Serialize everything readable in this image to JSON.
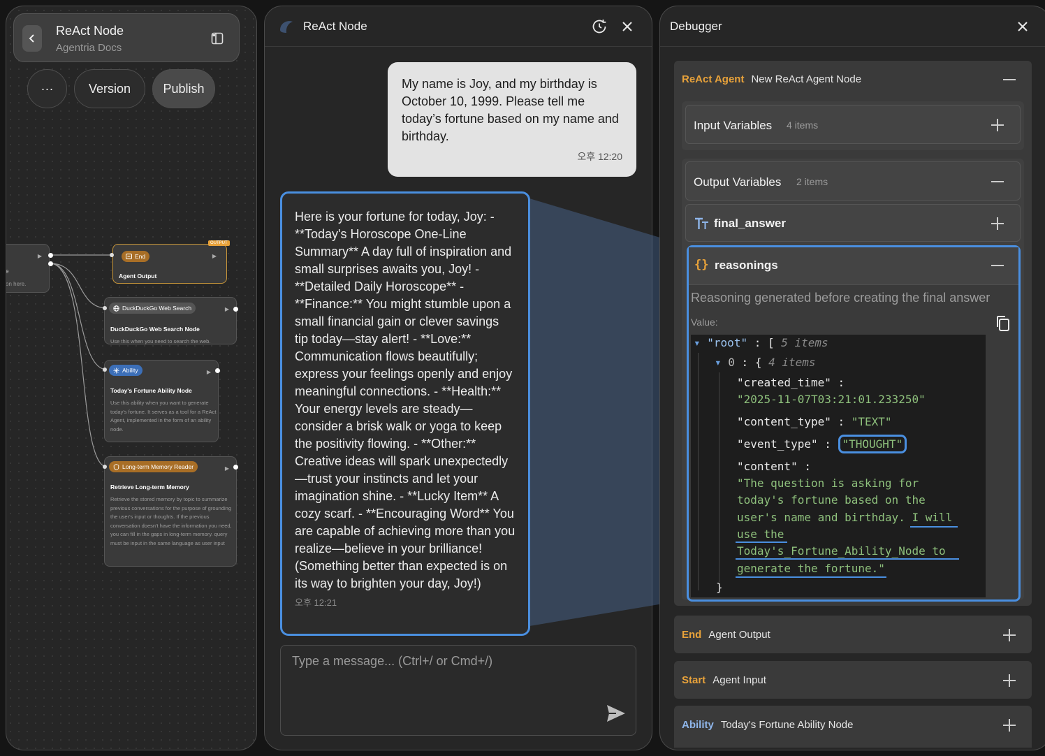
{
  "left_panel": {
    "title": "ReAct Node",
    "subtitle": "Agentria Docs",
    "more_label": "···",
    "version_label": "Version",
    "publish_label": "Publish",
    "partial_node_text1": "e",
    "partial_node_text2": "on here.",
    "nodes": {
      "end": {
        "badge": "End",
        "corner_tag": "OUTPUT",
        "title": "Agent Output"
      },
      "search": {
        "badge": "DuckDuckGo Web Search",
        "title": "DuckDuckGo Web Search Node",
        "desc": "Use this when you need to search the web."
      },
      "ability": {
        "badge": "Ability",
        "title": "Today's Fortune Ability Node",
        "desc": "Use this ability when you want to generate today's fortune. It serves as a tool for a ReAct Agent, implemented in the form of an ability node."
      },
      "memory": {
        "badge": "Long-term Memory Reader",
        "title": "Retrieve Long-term Memory",
        "desc": "Retrieve the stored memory by topic to summarize previous conversations for the purpose of grounding the user's input or thoughts. If the previous conversation doesn't have the information you need, you can fill in the gaps in long-term memory. query must be input in the same language as user input"
      }
    }
  },
  "chat": {
    "title": "ReAct Node",
    "user_message": "My name is Joy, and my birthday is October 10, 1999. Please tell me today’s fortune based on my name and birthday.",
    "user_time": "오후 12:20",
    "bot_message": "Here is your fortune for today, Joy: - **Today's Horoscope One-Line Summary** A day full of inspiration and small surprises awaits you, Joy! - **Detailed Daily Horoscope** - **Finance:** You might stumble upon a small financial gain or clever savings tip today—stay alert! - **Love:** Communication flows beautifully; express your feelings openly and enjoy meaningful connections. - **Health:** Your energy levels are steady—consider a brisk walk or yoga to keep the positivity flowing. - **Other:** Creative ideas will spark unexpectedly—trust your instincts and let your imagination shine. - **Lucky Item** A cozy scarf. - **Encouraging Word** You are capable of achieving more than you realize—believe in your brilliance! (Something better than expected is on its way to brighten your day, Joy!)",
    "bot_time": "오후 12:21",
    "composer_placeholder": "Type a message... (Ctrl+/ or Cmd+/)"
  },
  "debugger": {
    "title": "Debugger",
    "agent_tag": "ReAct Agent",
    "agent_name": "New ReAct Agent Node",
    "input_vars_label": "Input Variables",
    "input_vars_count": "4 items",
    "output_vars_label": "Output Variables",
    "output_vars_count": "2 items",
    "final_answer_label": "final_answer",
    "reasonings_label": "reasonings",
    "reasonings_desc": "Reasoning generated before creating the final answer",
    "value_label": "Value:",
    "json_view": {
      "root_key": "\"root\"",
      "root_count": "5 items",
      "item_index": "0",
      "item_count": "4 items",
      "created_time_key": "\"created_time\"",
      "created_time_val": "\"2025-11-07T03:21:01.233250\"",
      "content_type_key": "\"content_type\"",
      "content_type_val": "\"TEXT\"",
      "event_type_key": "\"event_type\"",
      "event_type_val": "\"THOUGHT\"",
      "content_key": "\"content\"",
      "content_val_1": "\"The question is asking for",
      "content_val_2": "today's fortune based on the",
      "content_val_3": "user's name and birthday. I will",
      "content_val_4": "use the",
      "content_val_5": "Today's_Fortune_Ability_Node to",
      "content_val_6": "generate the fortune.\""
    },
    "end_tag": "End",
    "end_name": "Agent Output",
    "start_tag": "Start",
    "start_name": "Agent Input",
    "ability_tag": "Ability",
    "ability_name": "Today's Fortune Ability Node"
  },
  "colors": {
    "highlight": "#4a8fe0",
    "accent_orange": "#e8a23a",
    "accent_blue": "#8fb6ea",
    "json_string": "#8ec07c"
  },
  "icons": {
    "back": "chevron-left-icon",
    "layout": "sidebar-layout-icon",
    "history": "history-icon",
    "close": "close-icon",
    "send": "send-icon",
    "copy": "copy-icon",
    "text_type": "text-type-icon",
    "object_type": "curly-braces-icon"
  }
}
